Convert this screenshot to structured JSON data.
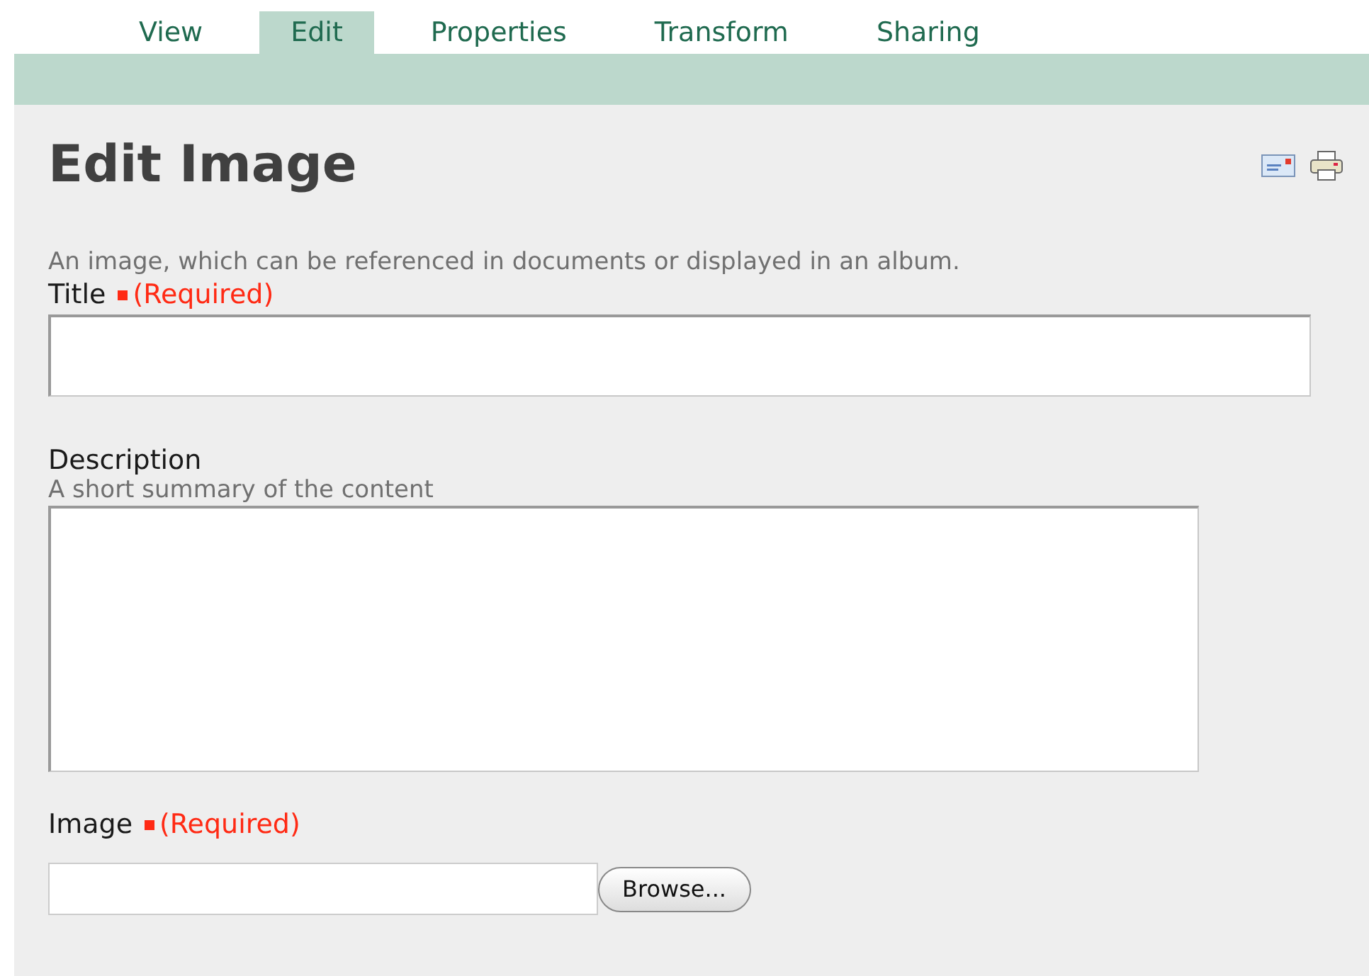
{
  "tabs": [
    {
      "label": "View",
      "selected": false
    },
    {
      "label": "Edit",
      "selected": true
    },
    {
      "label": "Properties",
      "selected": false
    },
    {
      "label": "Transform",
      "selected": false
    },
    {
      "label": "Sharing",
      "selected": false
    }
  ],
  "heading": "Edit Image",
  "intro": "An image, which can be referenced in documents or displayed in an album.",
  "fields": [
    {
      "kind": "text",
      "label": "Title",
      "required_text": "(Required)"
    },
    {
      "kind": "textarea",
      "label": "Description",
      "help": "A short summary of the content"
    },
    {
      "kind": "file",
      "label": "Image",
      "required_text": "(Required)",
      "button": "Browse..."
    }
  ]
}
